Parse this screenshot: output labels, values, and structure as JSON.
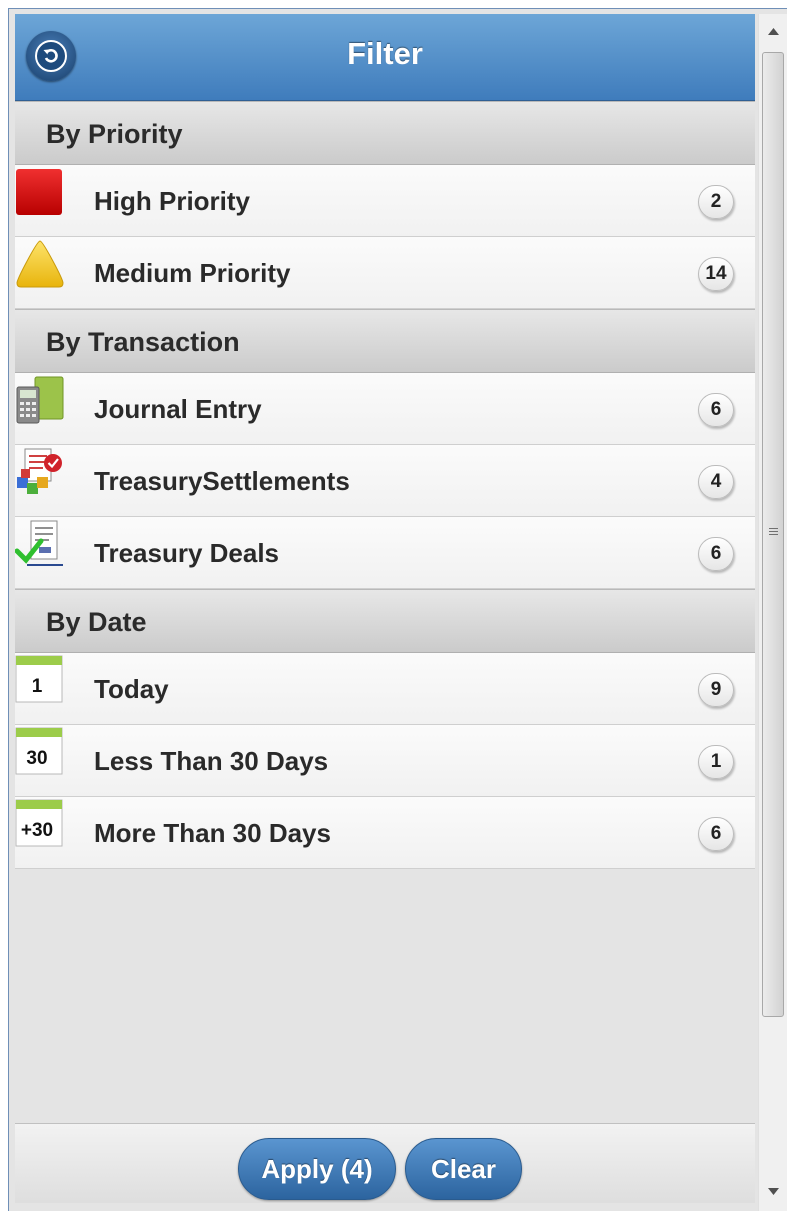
{
  "header": {
    "title": "Filter",
    "back_icon": "back-arrow-icon"
  },
  "groups": [
    {
      "heading": "By Priority",
      "items": [
        {
          "label": "High Priority",
          "count": "2",
          "icon": "red-square-icon"
        },
        {
          "label": "Medium Priority",
          "count": "14",
          "icon": "yellow-triangle-icon"
        }
      ]
    },
    {
      "heading": "By Transaction",
      "items": [
        {
          "label": "Journal Entry",
          "count": "6",
          "icon": "calculator-icon"
        },
        {
          "label": "TreasurySettlements",
          "count": "4",
          "icon": "settlement-icon"
        },
        {
          "label": "Treasury Deals",
          "count": "6",
          "icon": "document-check-icon"
        }
      ]
    },
    {
      "heading": "By Date",
      "items": [
        {
          "label": "Today",
          "count": "9",
          "icon": "calendar-icon",
          "calendar_text": "1"
        },
        {
          "label": "Less Than 30 Days",
          "count": "1",
          "icon": "calendar-icon",
          "calendar_text": "30"
        },
        {
          "label": "More Than 30 Days",
          "count": "6",
          "icon": "calendar-icon",
          "calendar_text": "+30"
        }
      ]
    }
  ],
  "footer": {
    "apply_label": "Apply (4)",
    "clear_label": "Clear"
  },
  "colors": {
    "header_top": "#6da6d7",
    "header_bottom": "#3f7cbc",
    "button": "#3a78b8"
  }
}
